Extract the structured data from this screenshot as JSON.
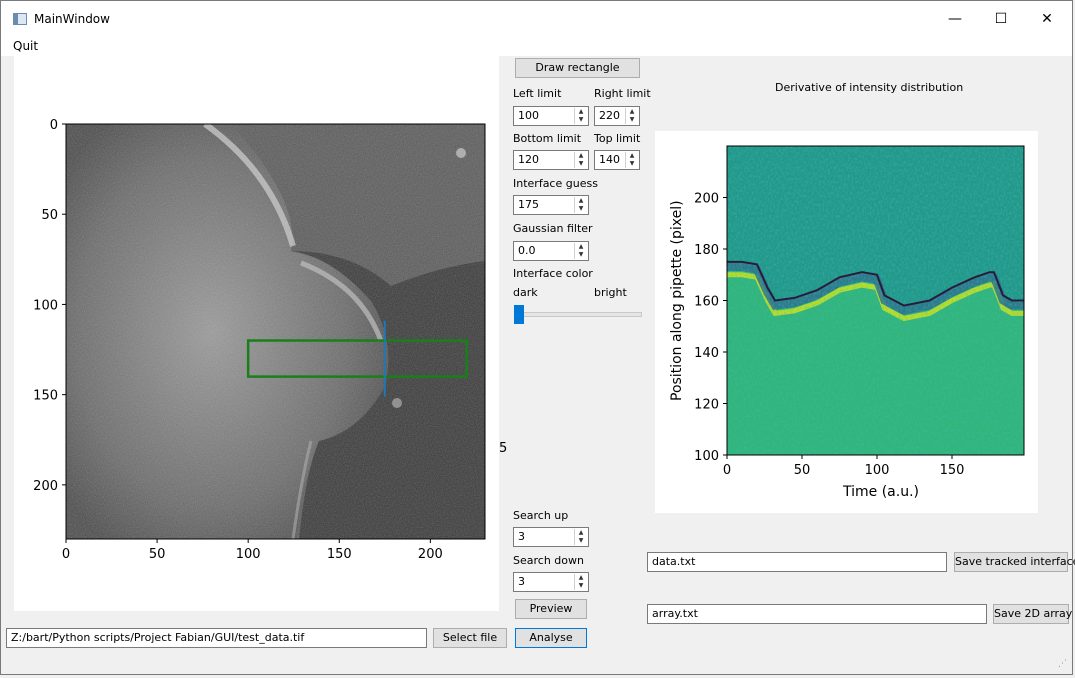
{
  "window": {
    "title": "MainWindow",
    "minimize_glyph": "—",
    "maximize_glyph": "☐",
    "close_glyph": "✕"
  },
  "menu": {
    "quit": "Quit"
  },
  "left_plot": {
    "y_ticks": [
      "0",
      "50",
      "100",
      "150",
      "200"
    ],
    "x_ticks": [
      "0",
      "50",
      "100",
      "150",
      "200"
    ],
    "rect_color": "#1a7f1a",
    "line_color": "#1f77b4"
  },
  "controls": {
    "draw_rectangle": "Draw rectangle",
    "left_limit_label": "Left limit",
    "left_limit": "100",
    "right_limit_label": "Right limit",
    "right_limit": "220",
    "bottom_limit_label": "Bottom limit",
    "bottom_limit": "120",
    "top_limit_label": "Top limit",
    "top_limit": "140",
    "interface_guess_label": "Interface guess",
    "interface_guess": "175",
    "gaussian_filter_label": "Gaussian filter",
    "gaussian_filter": "0.0",
    "interface_color_label": "Interface color",
    "dark_label": "dark",
    "bright_label": "bright",
    "interface_color_value": 0,
    "search_up_label": "Search up",
    "search_up": "3",
    "search_down_label": "Search down",
    "search_down": "3",
    "preview": "Preview",
    "analyse": "Analyse"
  },
  "file": {
    "path": "Z:/bart/Python scripts/Project Fabian/GUI/test_data.tif",
    "select": "Select file"
  },
  "right_plot": {
    "title": "Derivative of intensity distribution",
    "xlabel": "Time (a.u.)",
    "ylabel": "Position along pipette (pixel)",
    "x_ticks": [
      "0",
      "50",
      "100",
      "150"
    ],
    "y_ticks": [
      "100",
      "120",
      "140",
      "160",
      "180",
      "200"
    ]
  },
  "chart_data": {
    "type": "heatmap",
    "title": "Derivative of intensity distribution",
    "xlabel": "Time (a.u.)",
    "ylabel": "Position along pipette (pixel)",
    "xlim": [
      0,
      198
    ],
    "ylim": [
      100,
      220
    ],
    "interface": {
      "x": [
        0,
        10,
        20,
        27,
        32,
        45,
        60,
        75,
        90,
        100,
        105,
        118,
        135,
        150,
        165,
        175,
        178,
        184,
        190,
        198
      ],
      "y": [
        175,
        175,
        174,
        165,
        160,
        161,
        164,
        169,
        171,
        170,
        162,
        158,
        160,
        165,
        169,
        171,
        171,
        162,
        160,
        160
      ]
    }
  },
  "save": {
    "data_file": "data.txt",
    "save_tracked": "Save tracked interface",
    "array_file": "array.txt",
    "save_array": "Save 2D array"
  },
  "misc": {
    "stray_tick": "5"
  }
}
